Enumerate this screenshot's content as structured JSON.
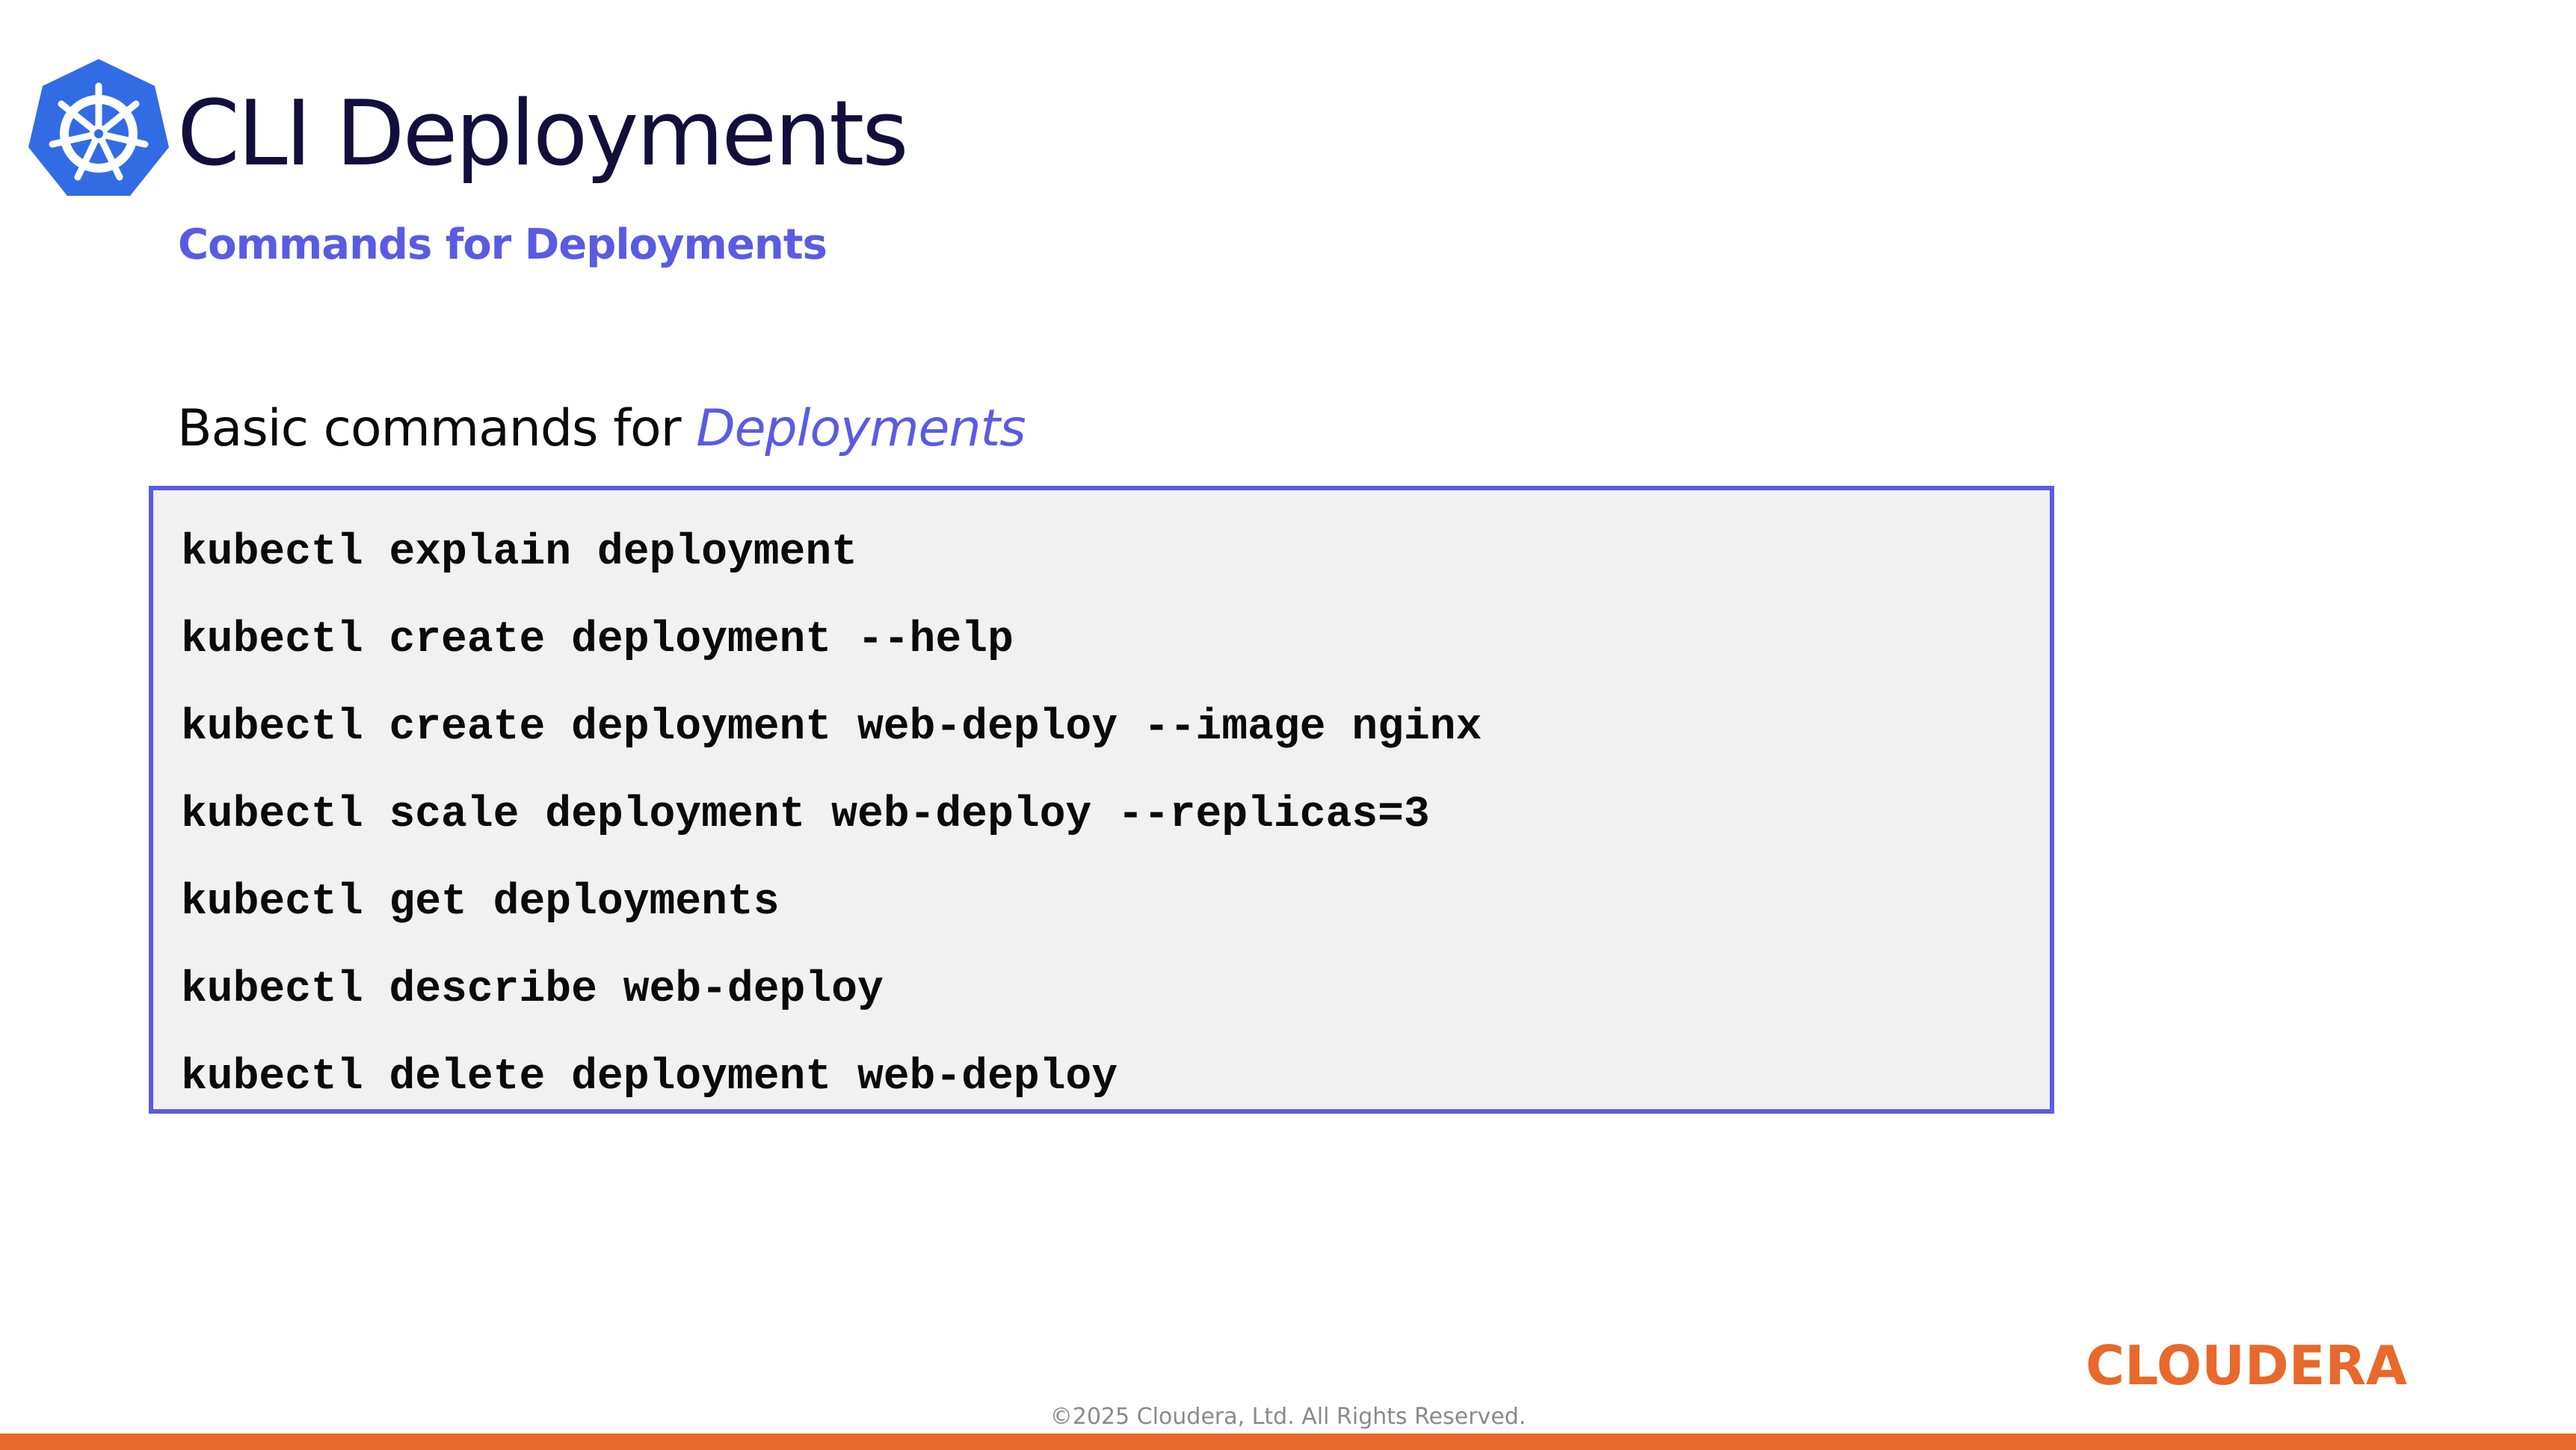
{
  "slide": {
    "title": "CLI Deployments",
    "subtitle": "Commands for Deployments",
    "section_heading": {
      "prefix": "Basic commands for ",
      "emphasis": "Deployments"
    },
    "commands": [
      "kubectl explain deployment",
      "kubectl create deployment --help",
      "kubectl create deployment web-deploy --image nginx",
      "kubectl scale deployment web-deploy --replicas=3",
      "kubectl get deployments",
      "kubectl describe web-deploy",
      "kubectl delete deployment web-deploy"
    ]
  },
  "footer": {
    "brand": "CLOUDERA",
    "copyright": "©2025 Cloudera, Ltd. All Rights Reserved."
  },
  "icons": {
    "logo": "kubernetes-helm-icon"
  },
  "colors": {
    "title": "#120f3d",
    "accent": "#5a5be3",
    "kubernetes_blue": "#326ce5",
    "brand_orange": "#e8692b",
    "code_background": "#f1f1f1",
    "copyright": "#8a8a8a"
  }
}
